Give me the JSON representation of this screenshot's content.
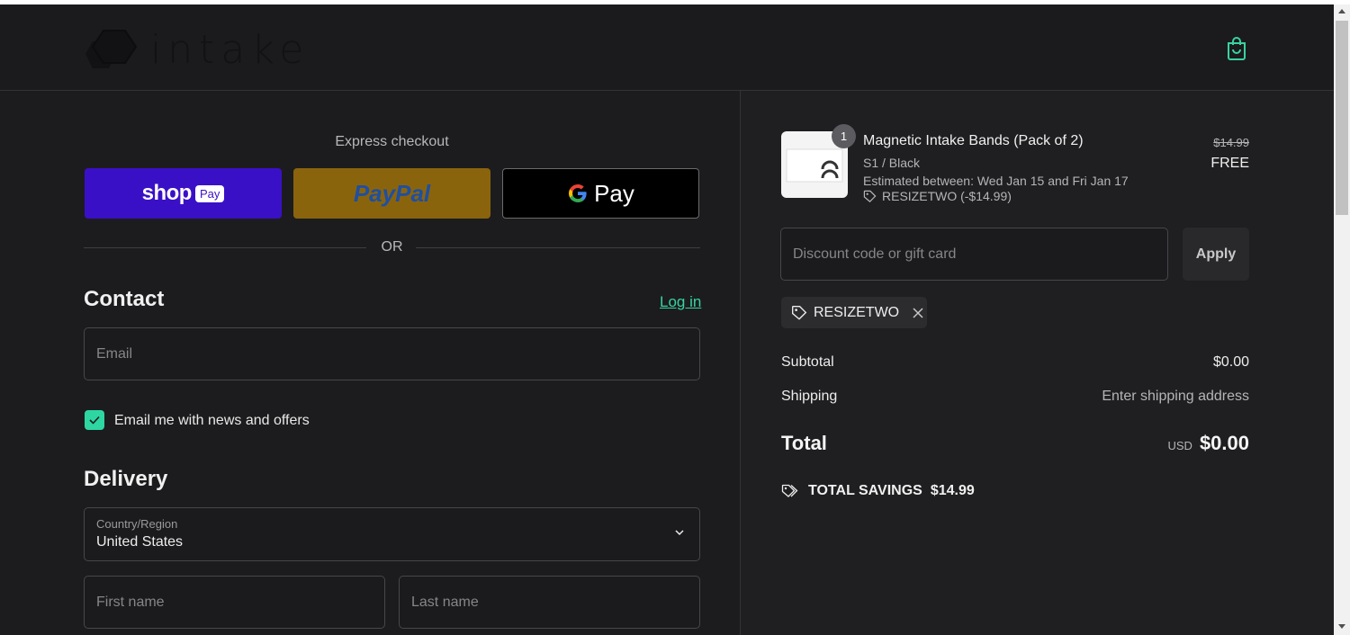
{
  "header": {
    "logo_text": "intake",
    "cart_icon": "shopping-bag-icon"
  },
  "express": {
    "title": "Express checkout",
    "shop_pay_word": "shop",
    "shop_pay_badge": "Pay",
    "paypal_label": "PayPal",
    "gpay_label": "Pay",
    "or_text": "OR"
  },
  "contact": {
    "heading": "Contact",
    "login_label": "Log in",
    "email_placeholder": "Email",
    "newsletter_label": "Email me with news and offers",
    "newsletter_checked": true
  },
  "delivery": {
    "heading": "Delivery",
    "country_label": "Country/Region",
    "country_value": "United States",
    "first_name_placeholder": "First name",
    "last_name_placeholder": "Last name"
  },
  "order": {
    "item": {
      "quantity": "1",
      "name": "Magnetic Intake Bands (Pack of 2)",
      "variant": "S1 / Black",
      "estimate": "Estimated between: Wed Jan 15 and Fri Jan 17",
      "discount": "RESIZETWO (-$14.99)",
      "price_original": "$14.99",
      "price_final": "FREE"
    },
    "discount_placeholder": "Discount code or gift card",
    "apply_label": "Apply",
    "applied_code": "RESIZETWO",
    "subtotal_label": "Subtotal",
    "subtotal_value": "$0.00",
    "shipping_label": "Shipping",
    "shipping_value": "Enter shipping address",
    "total_label": "Total",
    "total_currency": "USD",
    "total_value": "$0.00",
    "savings_label": "TOTAL SAVINGS",
    "savings_value": "$14.99"
  },
  "colors": {
    "accent": "#38d39f",
    "shop_pay": "#3a10c7",
    "paypal": "#8a640d",
    "background": "#1c1c1e"
  }
}
